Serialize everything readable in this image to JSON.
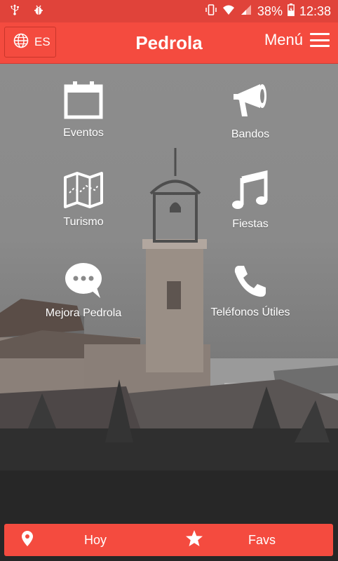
{
  "status_bar": {
    "battery_percent": "38%",
    "time": "12:38"
  },
  "header": {
    "language": "ES",
    "title": "Pedrola",
    "menu_label": "Menú"
  },
  "tiles": [
    {
      "label": "Eventos",
      "icon": "calendar-icon"
    },
    {
      "label": "Bandos",
      "icon": "megaphone-icon"
    },
    {
      "label": "Turismo",
      "icon": "map-icon"
    },
    {
      "label": "Fiestas",
      "icon": "music-note-icon"
    },
    {
      "label": "Mejora Pedrola",
      "icon": "chat-bubble-icon"
    },
    {
      "label": "Teléfonos Útiles",
      "icon": "phone-icon"
    }
  ],
  "bottom_bar": {
    "today_label": "Hoy",
    "favs_label": "Favs"
  },
  "colors": {
    "primary": "#f44b3f",
    "status_bar": "#e0433a"
  }
}
